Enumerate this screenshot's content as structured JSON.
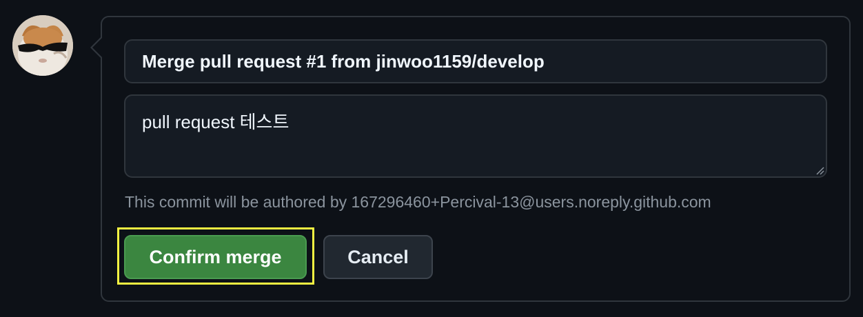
{
  "merge_form": {
    "commit_title": "Merge pull request #1 from jinwoo1159/develop",
    "commit_body": "pull request 테스트",
    "author_note": "This commit will be authored by 167296460+Percival-13@users.noreply.github.com",
    "confirm_label": "Confirm merge",
    "cancel_label": "Cancel"
  },
  "avatar": {
    "icon": "cat-with-sunglasses-avatar"
  },
  "colors": {
    "background": "#0d1117",
    "border": "#30363d",
    "confirm_green": "#3b8640",
    "highlight_yellow": "#f5f542",
    "muted_text": "#8b949e"
  }
}
